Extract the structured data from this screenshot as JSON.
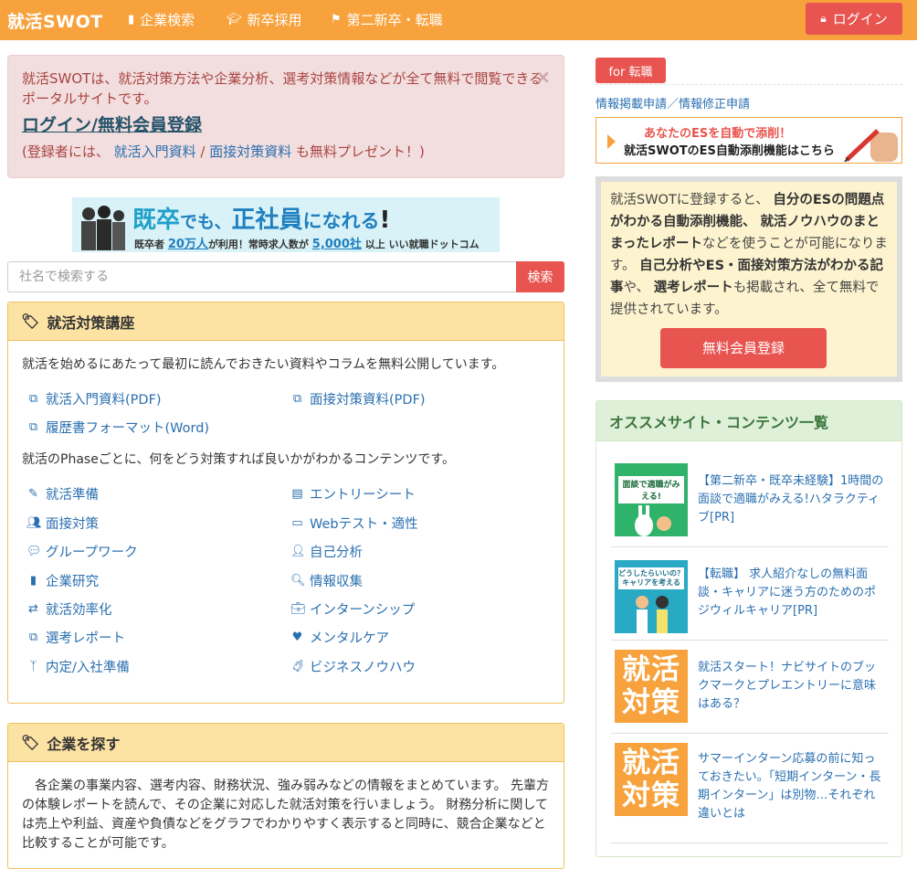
{
  "nav": {
    "brand": "就活SWOT",
    "items": [
      {
        "label": "企業検索",
        "icon": "building-icon"
      },
      {
        "label": "新卒採用",
        "icon": "graduation-cap-icon"
      },
      {
        "label": "第二新卒・転職",
        "icon": "flag-icon"
      }
    ],
    "login": "ログイン"
  },
  "alert": {
    "text": "就活SWOTは、就活対策方法や企業分析、選考対策情報などが全て無料で閲覧できるポータルサイトです。",
    "login_link": "ログイン/無料会員登録",
    "sub_prefix": "(登録者には、",
    "sub_link1": "就活入門資料",
    "sub_sep": " / ",
    "sub_link2": "面接対策資料",
    "sub_suffix": " も無料プレゼント！)"
  },
  "banner": {
    "t1a": "既卒",
    "t1b": "でも、",
    "t1c": "正社員",
    "t1d": "になれる",
    "t1e": "!",
    "t2a": "既卒者",
    "t2b": "20万人",
    "t2c": "が利用！常時求人数が",
    "t2d": "5,000社",
    "t2e": "以上",
    "logo": "いい就職ドットコム"
  },
  "search": {
    "placeholder": "社名で検索する",
    "button": "検索"
  },
  "course": {
    "title": "就活対策講座",
    "desc1": "就活を始めるにあたって最初に読んでおきたい資料やコラムを無料公開しています。",
    "docs": [
      "就活入門資料(PDF)",
      "面接対策資料(PDF)",
      "履歴書フォーマット(Word)"
    ],
    "desc2": "就活のPhaseごとに、何をどう対策すれば良いかがわかるコンテンツです。",
    "phases": [
      "就活準備",
      "エントリーシート",
      "面接対策",
      "Webテスト・適性",
      "グループワーク",
      "自己分析",
      "企業研究",
      "情報収集",
      "就活効率化",
      "インターンシップ",
      "選考レポート",
      "メンタルケア",
      "内定/入社準備",
      "ビジネスノウハウ"
    ]
  },
  "company": {
    "title": "企業を探す",
    "desc": "各企業の事業内容、選考内容、財務状況、強み弱みなどの情報をまとめています。 先輩方の体験レポートを読んで、その企業に対応した就活対策を行いましょう。 財務分析に関しては売上や利益、資産や負債などをグラフでわかりやすく表示すると同時に、競合企業などと比較することが可能です。"
  },
  "sidebar": {
    "tag": "for 転職",
    "links": "情報掲載申請／情報修正申請",
    "es_line1": "あなたのESを自動で添削！",
    "es_line2": "就活SWOTのES自動添削機能はこちら",
    "promo_parts": [
      {
        "t": "就活SWOTに登録すると、 ",
        "b": false
      },
      {
        "t": "自分のESの問題点がわかる自動添削機能、 就活ノウハウのまとまったレポート",
        "b": true
      },
      {
        "t": "などを使うことが可能になります。 ",
        "b": false
      },
      {
        "t": "自己分析やES・面接対策方法がわかる記事",
        "b": true
      },
      {
        "t": "や、 ",
        "b": false
      },
      {
        "t": "選考レポート",
        "b": true
      },
      {
        "t": "も掲載され、全て無料で提供されています。",
        "b": false
      }
    ],
    "register": "無料会員登録",
    "rec_title": "オススメサイト・コンテンツ一覧",
    "rec_items": [
      "【第二新卒・既卒未経験】1時間の面談で適職がみえる!ハタラクティブ[PR]",
      "【転職】 求人紹介なしの無料面談・キャリアに迷う方のためのポジウィルキャリア[PR]",
      "就活スタート！ナビサイトのブックマークとプレエントリーに意味はある？",
      "サマーインターン応募の前に知っておきたい。「短期インターン・長期インターン」は別物…それぞれ違いとは"
    ],
    "thumb_kanji": [
      "就活",
      "対策"
    ],
    "thumb1_text": "面談で適職がみえる!",
    "thumb2_text": "どうしたらいいの？キャリアを考える"
  },
  "colors": {
    "accent": "#f7a23c",
    "button": "#e8544f",
    "link": "#2a6fb0"
  }
}
